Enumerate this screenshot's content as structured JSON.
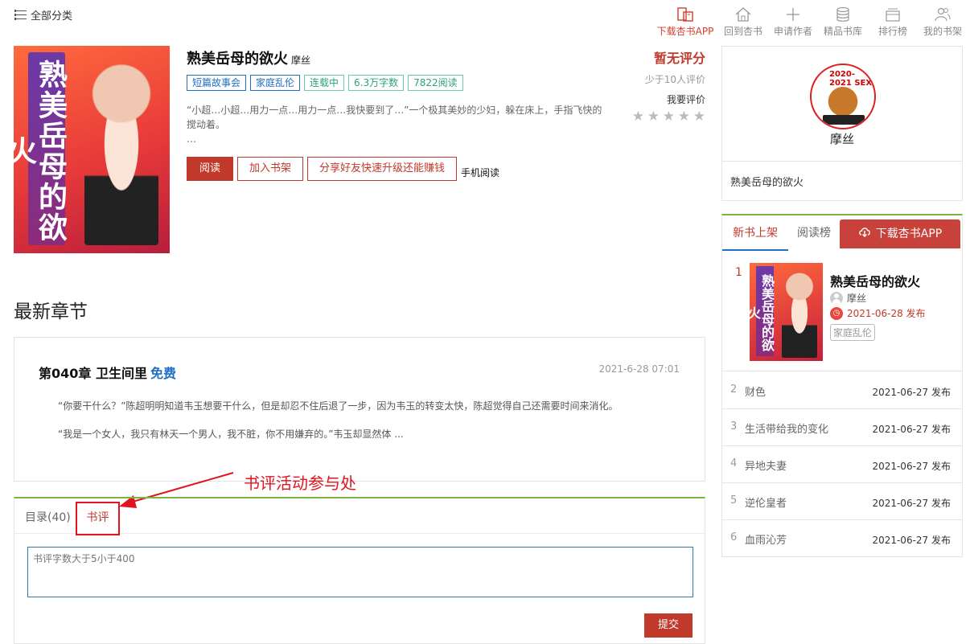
{
  "topbar": {
    "category_label": "全部分类",
    "nav": [
      {
        "label": "下载杏书APP",
        "icon": "app-download-icon",
        "active": true
      },
      {
        "label": "回到杏书",
        "icon": "home-icon",
        "active": false
      },
      {
        "label": "申请作者",
        "icon": "plus-icon",
        "active": false
      },
      {
        "label": "精品书库",
        "icon": "database-icon",
        "active": false
      },
      {
        "label": "排行榜",
        "icon": "ranking-box-icon",
        "active": false
      },
      {
        "label": "我的书架",
        "icon": "users-icon",
        "active": false
      }
    ]
  },
  "book": {
    "cover_text": "熟美岳母的欲火",
    "title": "熟美岳母的欲火",
    "author": "摩丝",
    "tags": [
      "短篇故事会",
      "家庭乱伦",
      "连载中",
      "6.3万字数",
      "7822阅读"
    ],
    "description": "“小超…小超…用力一点…用力一点…我快要到了…”一个极其美妙的少妇，躲在床上，手指飞快的搅动着。",
    "description_more": "…",
    "buttons": {
      "read": "阅读",
      "add_shelf": "加入书架",
      "share": "分享好友快速升级还能赚钱",
      "mobile": "手机阅读"
    },
    "score": {
      "label": "暂无评分",
      "count": "少于10人评价",
      "rate_label": "我要评价",
      "stars": 5
    }
  },
  "latest": {
    "heading": "最新章节",
    "chapter_title": "第040章 卫生间里",
    "free_label": "免费",
    "time": "2021-6-28 07:01",
    "para1": "“你要干什么？”陈超明明知道韦玉想要干什么，但是却忍不住后退了一步，因为韦玉的转变太快，陈超觉得自己还需要时间来消化。",
    "para2": "“我是一个女人，我只有林天一个男人，我不脏，你不用嫌弃的。”韦玉却显然体 ..."
  },
  "bottom": {
    "tab_catalog": "目录(40)",
    "tab_review": "书评",
    "review_placeholder": "书评字数大于5小于400",
    "submit": "提交",
    "annotation": "书评活动参与处"
  },
  "author_card": {
    "avatar_label": "2020-2021 SEX",
    "name": "摩丝",
    "book": "熟美岳母的欲火"
  },
  "ranking": {
    "tab_new": "新书上架",
    "tab_read": "阅读榜",
    "download": "下载杏书APP",
    "top": {
      "rank": "1",
      "cover_text": "熟美岳母的欲火",
      "title": "熟美岳母的欲火",
      "author": "摩丝",
      "date": "2021-06-28 发布",
      "tag": "家庭乱伦"
    },
    "items": [
      {
        "rank": "2",
        "title": "财色",
        "date": "2021-06-27 发布"
      },
      {
        "rank": "3",
        "title": "生活带给我的变化",
        "date": "2021-06-27 发布"
      },
      {
        "rank": "4",
        "title": "异地夫妻",
        "date": "2021-06-27 发布"
      },
      {
        "rank": "5",
        "title": "逆伦皇者",
        "date": "2021-06-27 发布"
      },
      {
        "rank": "6",
        "title": "血雨沁芳",
        "date": "2021-06-27 发布"
      }
    ]
  },
  "colors": {
    "accent": "#c0392b",
    "blue": "#1f6fc5",
    "green": "#7cb342",
    "annotation": "#e0141e"
  }
}
